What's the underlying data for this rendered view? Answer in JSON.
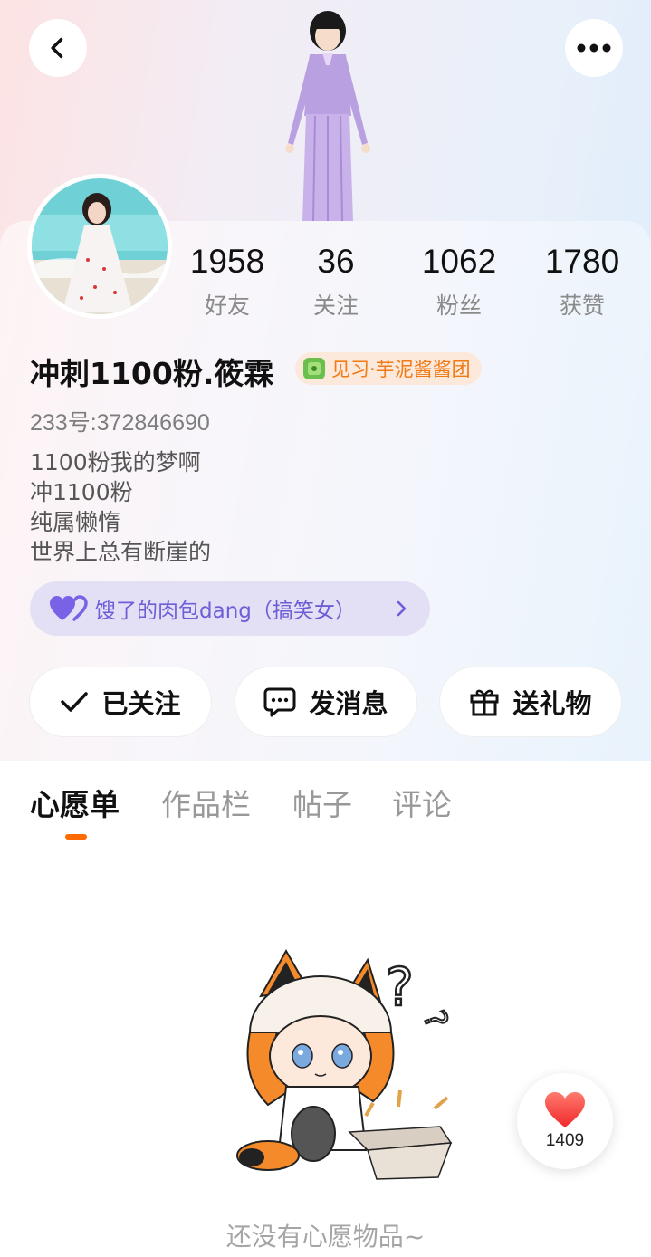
{
  "header": {
    "back_icon": "chevron-left-icon",
    "more_icon": "more-dots-icon"
  },
  "profile": {
    "stats": [
      {
        "value": "1958",
        "label": "好友"
      },
      {
        "value": "36",
        "label": "关注"
      },
      {
        "value": "1062",
        "label": "粉丝"
      },
      {
        "value": "1780",
        "label": "获赞"
      }
    ],
    "username": "冲刺1100粉.筱霖",
    "badge_text": "见习·芋泥酱酱团",
    "uid": "233号:372846690",
    "bio_lines": [
      "1100粉我的梦啊",
      "冲1100粉",
      "纯属懒惰",
      "世界上总有断崖的"
    ],
    "cp_text": "馊了的肉包dang（搞笑女）"
  },
  "actions": {
    "follow_label": "已关注",
    "message_label": "发消息",
    "gift_label": "送礼物"
  },
  "tabs": [
    {
      "label": "心愿单",
      "active": true
    },
    {
      "label": "作品栏",
      "active": false
    },
    {
      "label": "帖子",
      "active": false
    },
    {
      "label": "评论",
      "active": false
    }
  ],
  "empty_state": {
    "text": "还没有心愿物品~"
  },
  "like_button": {
    "count": "1409"
  },
  "colors": {
    "accent": "#ff6a00",
    "badge_text": "#f07a14",
    "cp_purple": "#6d5ed6"
  }
}
